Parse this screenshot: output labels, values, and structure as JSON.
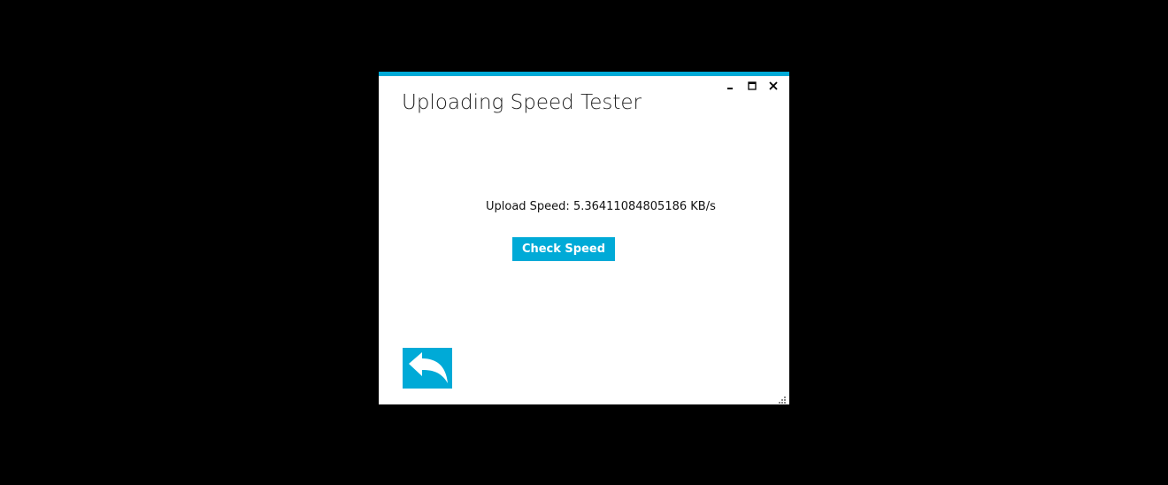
{
  "window": {
    "title": "Uploading Speed Tester",
    "accent_color": "#00aad7"
  },
  "caption": {
    "minimize_icon": "minimize-icon",
    "maximize_icon": "maximize-icon",
    "close_icon": "close-icon"
  },
  "main": {
    "upload_speed_text": "Upload Speed: 5.36411084805186 KB/s",
    "check_button_label": "Check Speed",
    "back_icon": "reply-arrow-icon"
  }
}
